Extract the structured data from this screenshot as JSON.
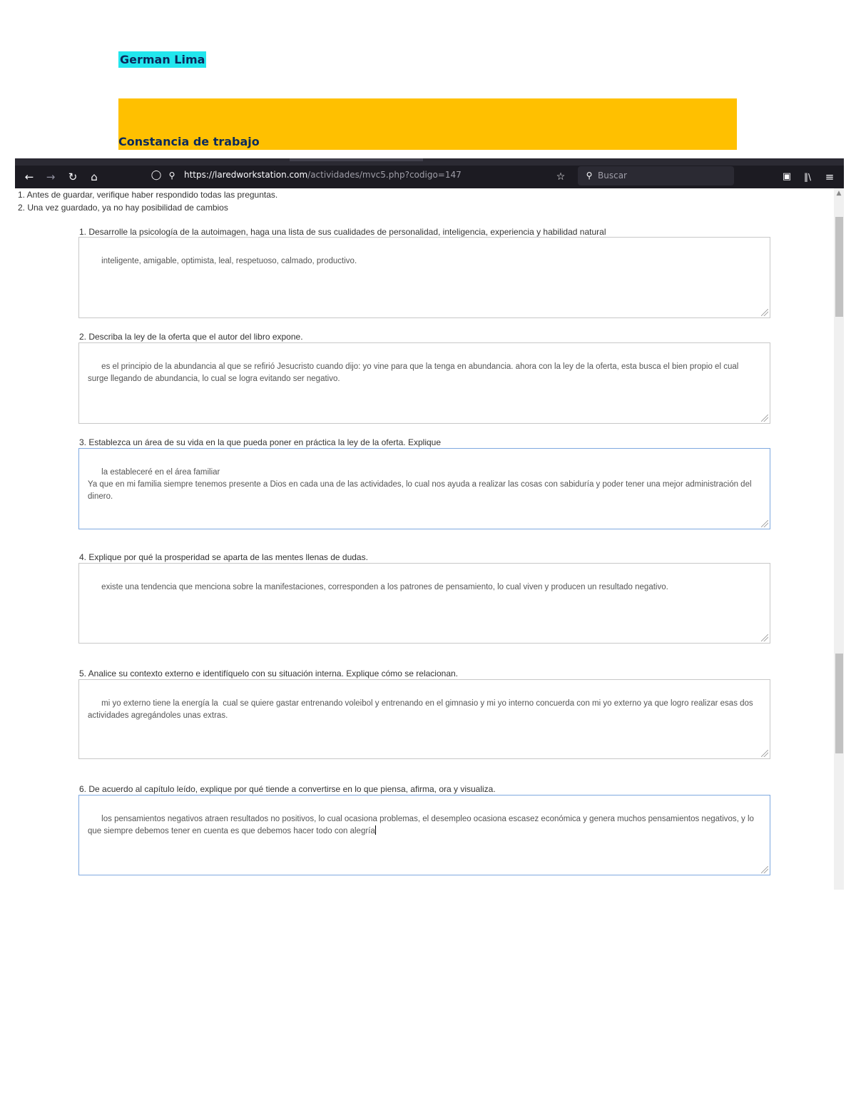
{
  "document": {
    "name": "German Lima",
    "banner_title": "Constancia de trabajo"
  },
  "browser": {
    "url_host": "https://laredworkstation.com",
    "url_path": "/actividades/mvc5.php?codigo=147",
    "search_placeholder": "Buscar",
    "icons": [
      "back-arrow-icon",
      "forward-arrow-icon",
      "reload-icon",
      "home-icon",
      "shield-icon",
      "lock-icon",
      "bookmark-star-icon",
      "search-icon",
      "pocket-icon",
      "library-icon",
      "menu-icon"
    ]
  },
  "instructions": [
    "1. Antes de guardar, verifique haber respondido todas las preguntas.",
    "2. Una vez guardado, ya no hay posibilidad de cambios"
  ],
  "questions": [
    {
      "label": "1. Desarrolle la psicología de la autoimagen, haga una lista de sus cualidades de personalidad, inteligencia, experiencia y habilidad natural",
      "answer": "inteligente, amigable, optimista, leal, respetuoso, calmado, productivo."
    },
    {
      "label": "2. Describa la ley de la oferta que el autor del libro expone.",
      "answer": "es el principio de la abundancia al que se refirió Jesucristo cuando dijo: yo vine para que la tenga en abundancia. ahora con la ley de la oferta, esta busca el bien propio el cual surge llegando de abundancia, lo cual se logra evitando ser negativo."
    },
    {
      "label": "3. Establezca un área de su vida en la que pueda poner en práctica la ley de la oferta. Explique",
      "answer": "la estableceré en el área familiar\nYa que en mi familia siempre tenemos presente a Dios en cada una de las actividades, lo cual nos ayuda a realizar las cosas con sabiduría y poder tener una mejor administración del dinero."
    },
    {
      "label": "4. Explique por qué la prosperidad se aparta de las mentes llenas de dudas.",
      "answer": "existe una tendencia que menciona sobre la manifestaciones, corresponden a los patrones de pensamiento, lo cual viven y producen un resultado negativo."
    },
    {
      "label": "5. Analice su contexto externo e identifíquelo con su situación interna. Explique cómo se relacionan.",
      "answer": "mi yo externo tiene la energía la  cual se quiere gastar entrenando voleibol y entrenando en el gimnasio y mi yo interno concuerda con mi yo externo ya que logro realizar esas dos actividades agregándoles unas extras."
    },
    {
      "label": "6. De acuerdo al capítulo leído, explique por qué tiende a convertirse en lo que piensa, afirma, ora y visualiza.",
      "answer": "los pensamientos negativos atraen resultados no positivos, lo cual ocasiona problemas, el desempleo ocasiona escasez económica y genera muchos pensamientos negativos, y lo que siempre debemos tener en cuenta es que debemos hacer todo con alegría"
    }
  ]
}
